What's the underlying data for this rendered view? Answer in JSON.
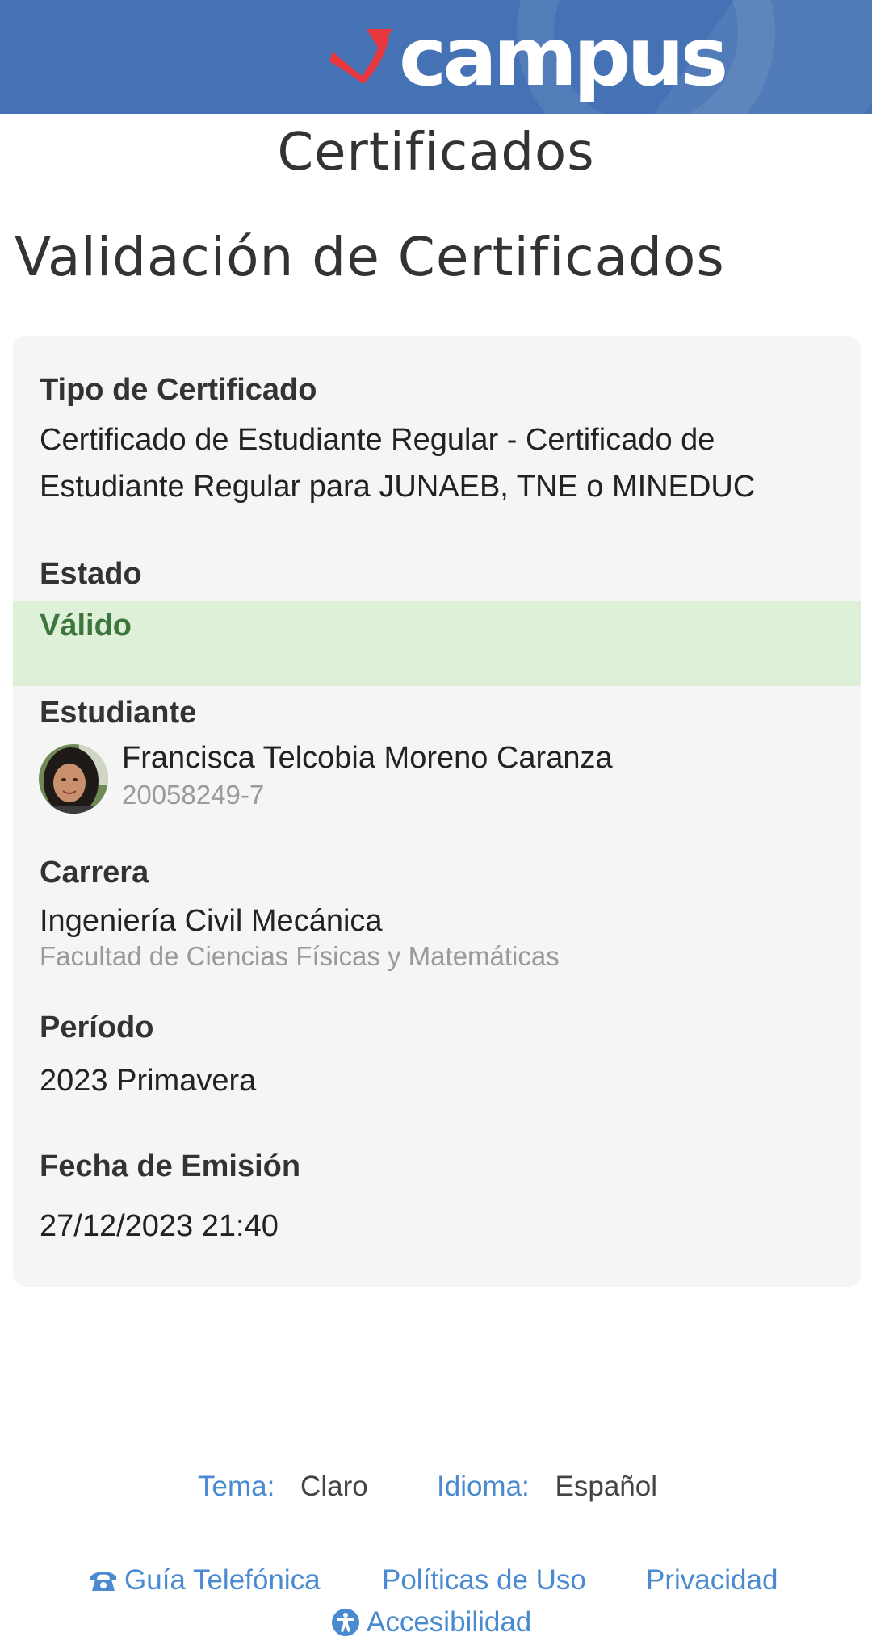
{
  "header": {
    "logo_text": "campus"
  },
  "page": {
    "title": "Certificados",
    "section_title": "Validación de Certificados"
  },
  "certificate": {
    "tipo_label": "Tipo de Certificado",
    "tipo_value": "Certificado de Estudiante Regular - Certificado de Estudiante Regular para JUNAEB, TNE o MINEDUC",
    "estado_label": "Estado",
    "estado_value": "Válido",
    "estudiante_label": "Estudiante",
    "student_name": "Francisca Telcobia Moreno Caranza",
    "student_id": "20058249-7",
    "carrera_label": "Carrera",
    "carrera_value": "Ingeniería Civil Mecánica",
    "facultad_value": "Facultad de Ciencias Físicas y Matemáticas",
    "periodo_label": "Período",
    "periodo_value": "2023 Primavera",
    "fecha_label": "Fecha de Emisión",
    "fecha_value": "27/12/2023 21:40"
  },
  "preferences": {
    "tema_label": "Tema:",
    "tema_value": "Claro",
    "idioma_label": "Idioma:",
    "idioma_value": "Español"
  },
  "footer": {
    "guia": "Guía Telefónica",
    "politicas": "Políticas de Uso",
    "privacidad": "Privacidad",
    "accesibilidad": "Accesibilidad"
  },
  "colors": {
    "header_bg": "#4472b4",
    "valid_bg": "#dff0d8",
    "valid_text": "#3c763d",
    "link": "#4a8ad0",
    "logo_accent": "#e8383d"
  }
}
